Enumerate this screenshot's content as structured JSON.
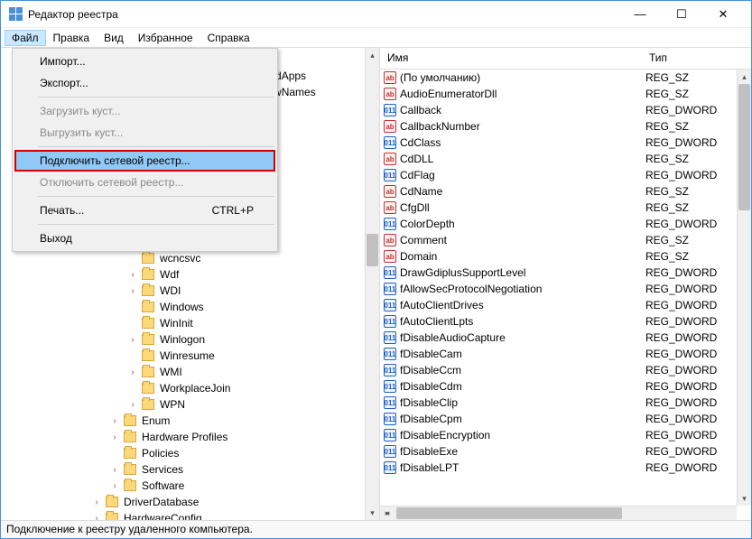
{
  "window": {
    "title": "Редактор реестра"
  },
  "menubar": [
    "Файл",
    "Правка",
    "Вид",
    "Избранное",
    "Справка"
  ],
  "file_menu": {
    "import": "Импорт...",
    "export": "Экспорт...",
    "load_hive": "Загрузить куст...",
    "unload_hive": "Выгрузить куст...",
    "connect_net": "Подключить сетевой реестр...",
    "disconnect_net": "Отключить сетевой реестр...",
    "print": "Печать...",
    "print_shortcut": "CTRL+P",
    "exit": "Выход"
  },
  "tree_partial_top": [
    {
      "label": "owedApps",
      "indent": 140
    },
    {
      "label": "adowNames",
      "indent": 140
    }
  ],
  "tree_items": [
    {
      "label": "wcncsvc",
      "indent": 140,
      "expand": ""
    },
    {
      "label": "Wdf",
      "indent": 140,
      "expand": "›"
    },
    {
      "label": "WDI",
      "indent": 140,
      "expand": "›"
    },
    {
      "label": "Windows",
      "indent": 140,
      "expand": ""
    },
    {
      "label": "WinInit",
      "indent": 140,
      "expand": ""
    },
    {
      "label": "Winlogon",
      "indent": 140,
      "expand": "›"
    },
    {
      "label": "Winresume",
      "indent": 140,
      "expand": ""
    },
    {
      "label": "WMI",
      "indent": 140,
      "expand": "›"
    },
    {
      "label": "WorkplaceJoin",
      "indent": 140,
      "expand": ""
    },
    {
      "label": "WPN",
      "indent": 140,
      "expand": "›"
    },
    {
      "label": "Enum",
      "indent": 120,
      "expand": "›"
    },
    {
      "label": "Hardware Profiles",
      "indent": 120,
      "expand": "›"
    },
    {
      "label": "Policies",
      "indent": 120,
      "expand": ""
    },
    {
      "label": "Services",
      "indent": 120,
      "expand": "›"
    },
    {
      "label": "Software",
      "indent": 120,
      "expand": "›"
    },
    {
      "label": "DriverDatabase",
      "indent": 100,
      "expand": "›"
    },
    {
      "label": "HardwareConfig",
      "indent": 100,
      "expand": "›"
    }
  ],
  "list_header": {
    "name": "Имя",
    "type": "Тип"
  },
  "registry_values": [
    {
      "name": "(По умолчанию)",
      "type": "REG_SZ",
      "icon": "sz"
    },
    {
      "name": "AudioEnumeratorDll",
      "type": "REG_SZ",
      "icon": "sz"
    },
    {
      "name": "Callback",
      "type": "REG_DWORD",
      "icon": "dw"
    },
    {
      "name": "CallbackNumber",
      "type": "REG_SZ",
      "icon": "sz"
    },
    {
      "name": "CdClass",
      "type": "REG_DWORD",
      "icon": "dw"
    },
    {
      "name": "CdDLL",
      "type": "REG_SZ",
      "icon": "sz"
    },
    {
      "name": "CdFlag",
      "type": "REG_DWORD",
      "icon": "dw"
    },
    {
      "name": "CdName",
      "type": "REG_SZ",
      "icon": "sz"
    },
    {
      "name": "CfgDll",
      "type": "REG_SZ",
      "icon": "sz"
    },
    {
      "name": "ColorDepth",
      "type": "REG_DWORD",
      "icon": "dw"
    },
    {
      "name": "Comment",
      "type": "REG_SZ",
      "icon": "sz"
    },
    {
      "name": "Domain",
      "type": "REG_SZ",
      "icon": "sz"
    },
    {
      "name": "DrawGdiplusSupportLevel",
      "type": "REG_DWORD",
      "icon": "dw"
    },
    {
      "name": "fAllowSecProtocolNegotiation",
      "type": "REG_DWORD",
      "icon": "dw"
    },
    {
      "name": "fAutoClientDrives",
      "type": "REG_DWORD",
      "icon": "dw"
    },
    {
      "name": "fAutoClientLpts",
      "type": "REG_DWORD",
      "icon": "dw"
    },
    {
      "name": "fDisableAudioCapture",
      "type": "REG_DWORD",
      "icon": "dw"
    },
    {
      "name": "fDisableCam",
      "type": "REG_DWORD",
      "icon": "dw"
    },
    {
      "name": "fDisableCcm",
      "type": "REG_DWORD",
      "icon": "dw"
    },
    {
      "name": "fDisableCdm",
      "type": "REG_DWORD",
      "icon": "dw"
    },
    {
      "name": "fDisableClip",
      "type": "REG_DWORD",
      "icon": "dw"
    },
    {
      "name": "fDisableCpm",
      "type": "REG_DWORD",
      "icon": "dw"
    },
    {
      "name": "fDisableEncryption",
      "type": "REG_DWORD",
      "icon": "dw"
    },
    {
      "name": "fDisableExe",
      "type": "REG_DWORD",
      "icon": "dw"
    },
    {
      "name": "fDisableLPT",
      "type": "REG_DWORD",
      "icon": "dw"
    }
  ],
  "statusbar": "Подключение к реестру удаленного компьютера."
}
